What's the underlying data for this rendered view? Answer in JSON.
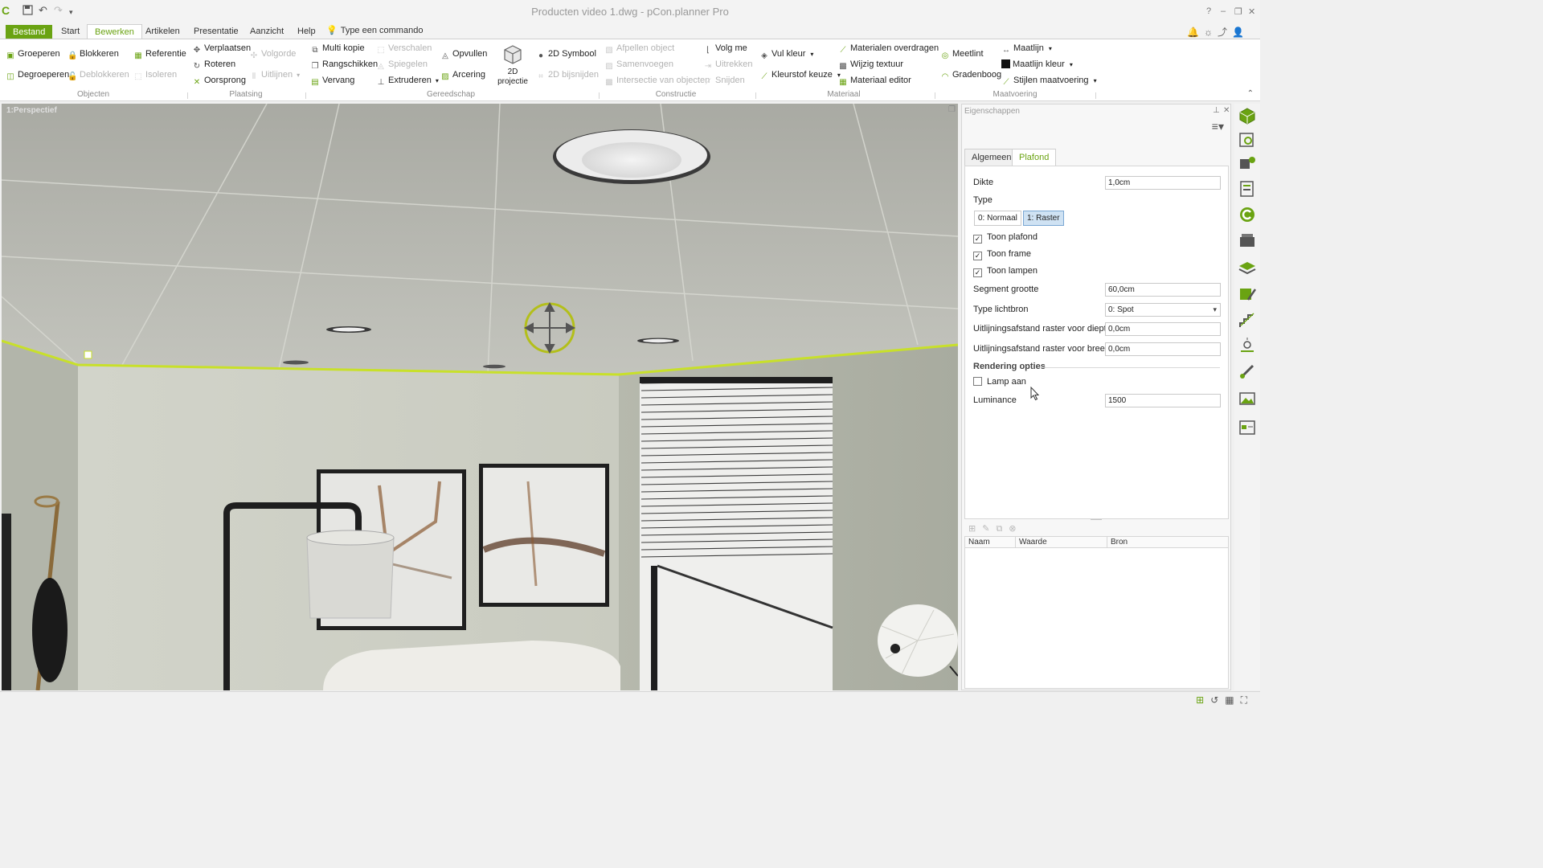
{
  "window": {
    "title": "Producten video 1.dwg - pCon.planner Pro",
    "controls": [
      "?",
      "–",
      "❐",
      "✕"
    ]
  },
  "menu": {
    "file_tab": "Bestand",
    "tabs": [
      "Start",
      "Bewerken",
      "Artikelen",
      "Presentatie",
      "Aanzicht",
      "Help"
    ],
    "active_tab": "Bewerken",
    "command_placeholder": "Type een commando"
  },
  "ribbon": {
    "objecten": {
      "label": "Objecten",
      "groeperen": "Groeperen",
      "blokkeren": "Blokkeren",
      "degroeperen": "Degroeperen",
      "deblokkeren": "Deblokkeren"
    },
    "plaatsing": {
      "label": "Plaatsing",
      "referentie": "Referentie",
      "isoleren": "Isoleren",
      "verplaatsen": "Verplaatsen",
      "roteren": "Roteren",
      "oorsprong": "Oorsprong",
      "volgorde": "Volgorde",
      "uitlijnen": "Uitlijnen"
    },
    "gereedschap": {
      "label": "Gereedschap",
      "multi_kopie": "Multi kopie",
      "rangschikken": "Rangschikken",
      "vervang": "Vervang",
      "verschalen": "Verschalen",
      "spiegelen": "Spiegelen",
      "extruderen": "Extruderen",
      "opvullen": "Opvullen",
      "arcering": "Arcering",
      "projectie_2d": "2D\nprojectie"
    },
    "constructie": {
      "label": "Constructie",
      "symbool_2d": "2D Symbool",
      "bijsnijden_2d": "2D bijsnijden",
      "afpellen": "Afpellen object",
      "samenvoegen": "Samenvoegen",
      "intersectie": "Intersectie van objecten",
      "volg_me": "Volg me",
      "uitrekken": "Uitrekken",
      "snijden": "Snijden"
    },
    "materiaal": {
      "label": "Materiaal",
      "vul_kleur": "Vul kleur",
      "kleurstof_keuze": "Kleurstof keuze",
      "materialen_overdragen": "Materialen overdragen",
      "wijzig_textuur": "Wijzig textuur",
      "materiaal_editor": "Materiaal editor"
    },
    "maatvoering": {
      "label": "Maatvoering",
      "meetlint": "Meetlint",
      "gradenboog": "Gradenboog",
      "maatlijn": "Maatlijn",
      "maatlijn_kleur": "Maatlijn kleur",
      "stijlen_maatvoering": "Stijlen maatvoering"
    }
  },
  "viewport": {
    "label": "1:Perspectief"
  },
  "properties": {
    "title": "Eigenschappen",
    "tabs": [
      "Algemeen",
      "Plafond"
    ],
    "active_tab": "Plafond",
    "dikte": {
      "label": "Dikte",
      "value": "1,0cm"
    },
    "type": {
      "label": "Type",
      "options": [
        "0: Normaal",
        "1: Raster"
      ],
      "selected": "1: Raster"
    },
    "toon_plafond": {
      "label": "Toon plafond",
      "checked": true
    },
    "toon_frame": {
      "label": "Toon frame",
      "checked": true
    },
    "toon_lampen": {
      "label": "Toon lampen",
      "checked": true
    },
    "segment_grootte": {
      "label": "Segment grootte",
      "value": "60,0cm"
    },
    "type_lichtbron": {
      "label": "Type lichtbron",
      "value": "0: Spot"
    },
    "uitlijning_diepte": {
      "label": "Uitlijningsafstand raster voor diepte",
      "value": "0,0cm"
    },
    "uitlijning_breedte": {
      "label": "Uitlijningsafstand raster voor breedte",
      "value": "0,0cm"
    },
    "rendering_opties": "Rendering opties",
    "lamp_aan": {
      "label": "Lamp aan",
      "checked": false
    },
    "luminance": {
      "label": "Luminance",
      "value": "1500"
    },
    "table_headers": [
      "Naam",
      "Waarde",
      "Bron"
    ]
  },
  "colors": {
    "accent": "#6aa312",
    "selection_outline": "#c8e02a",
    "toggle_selected": "#cfe2f3"
  }
}
